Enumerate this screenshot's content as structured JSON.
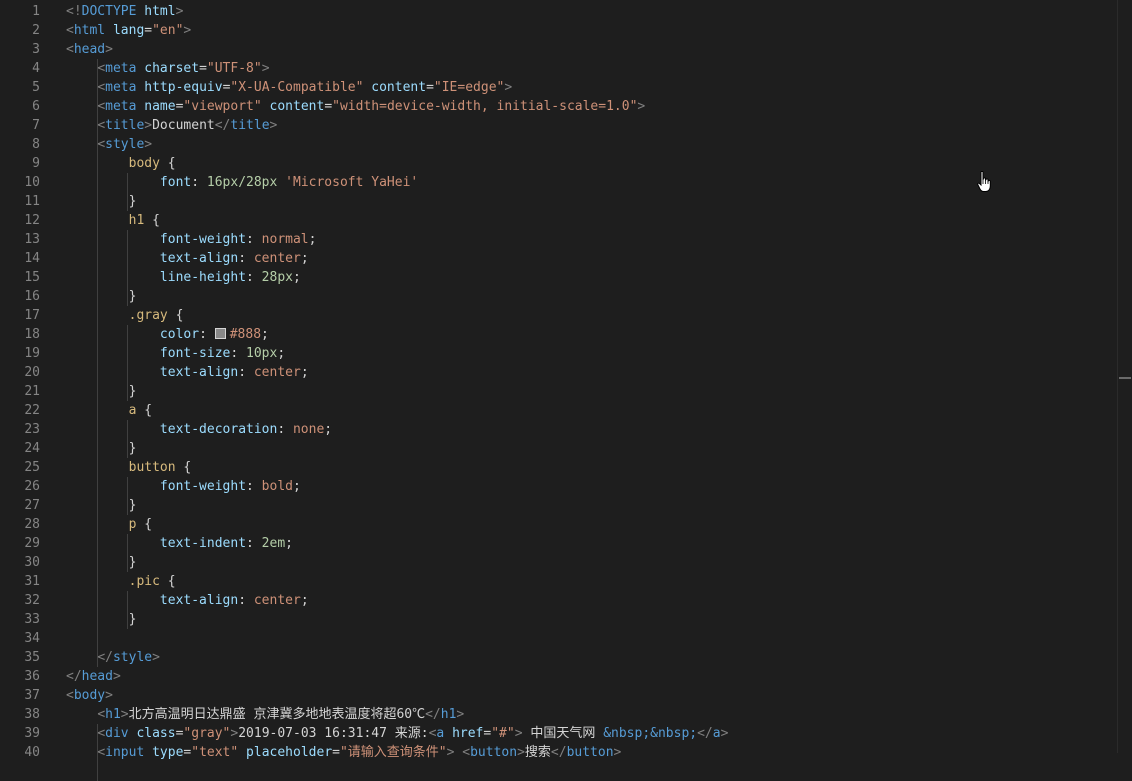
{
  "editor": {
    "line_numbers": [
      "1",
      "2",
      "3",
      "4",
      "5",
      "6",
      "7",
      "8",
      "9",
      "10",
      "11",
      "12",
      "13",
      "14",
      "15",
      "16",
      "17",
      "18",
      "19",
      "20",
      "21",
      "22",
      "23",
      "24",
      "25",
      "26",
      "27",
      "28",
      "29",
      "30",
      "31",
      "32",
      "33",
      "34",
      "35",
      "36",
      "37",
      "38",
      "39",
      "40"
    ],
    "lines": [
      [
        [
          "punc",
          "<!"
        ],
        [
          "tag",
          "DOCTYPE"
        ],
        [
          "text",
          " "
        ],
        [
          "attr",
          "html"
        ],
        [
          "punc",
          ">"
        ]
      ],
      [
        [
          "punc",
          "<"
        ],
        [
          "tag",
          "html"
        ],
        [
          "text",
          " "
        ],
        [
          "attr",
          "lang"
        ],
        [
          "text",
          "="
        ],
        [
          "str",
          "\"en\""
        ],
        [
          "punc",
          ">"
        ]
      ],
      [
        [
          "punc",
          "<"
        ],
        [
          "tag",
          "head"
        ],
        [
          "punc",
          ">"
        ]
      ],
      [
        [
          "text",
          "    "
        ],
        [
          "punc",
          "<"
        ],
        [
          "tag",
          "meta"
        ],
        [
          "text",
          " "
        ],
        [
          "attr",
          "charset"
        ],
        [
          "text",
          "="
        ],
        [
          "str",
          "\"UTF-8\""
        ],
        [
          "punc",
          ">"
        ]
      ],
      [
        [
          "text",
          "    "
        ],
        [
          "punc",
          "<"
        ],
        [
          "tag",
          "meta"
        ],
        [
          "text",
          " "
        ],
        [
          "attr",
          "http-equiv"
        ],
        [
          "text",
          "="
        ],
        [
          "str",
          "\"X-UA-Compatible\""
        ],
        [
          "text",
          " "
        ],
        [
          "attr",
          "content"
        ],
        [
          "text",
          "="
        ],
        [
          "str",
          "\"IE=edge\""
        ],
        [
          "punc",
          ">"
        ]
      ],
      [
        [
          "text",
          "    "
        ],
        [
          "punc",
          "<"
        ],
        [
          "tag",
          "meta"
        ],
        [
          "text",
          " "
        ],
        [
          "attr",
          "name"
        ],
        [
          "text",
          "="
        ],
        [
          "str",
          "\"viewport\""
        ],
        [
          "text",
          " "
        ],
        [
          "attr",
          "content"
        ],
        [
          "text",
          "="
        ],
        [
          "str",
          "\"width=device-width, initial-scale=1.0\""
        ],
        [
          "punc",
          ">"
        ]
      ],
      [
        [
          "text",
          "    "
        ],
        [
          "punc",
          "<"
        ],
        [
          "tag",
          "title"
        ],
        [
          "punc",
          ">"
        ],
        [
          "text",
          "Document"
        ],
        [
          "punc",
          "</"
        ],
        [
          "tag",
          "title"
        ],
        [
          "punc",
          ">"
        ]
      ],
      [
        [
          "text",
          "    "
        ],
        [
          "punc",
          "<"
        ],
        [
          "tag",
          "style"
        ],
        [
          "punc",
          ">"
        ]
      ],
      [
        [
          "text",
          "        "
        ],
        [
          "sel",
          "body"
        ],
        [
          "text",
          " {"
        ]
      ],
      [
        [
          "text",
          "            "
        ],
        [
          "prop",
          "font"
        ],
        [
          "text",
          ": "
        ],
        [
          "num",
          "16px/28px"
        ],
        [
          "text",
          " "
        ],
        [
          "str",
          "'Microsoft YaHei'"
        ]
      ],
      [
        [
          "text",
          "        }"
        ]
      ],
      [
        [
          "text",
          "        "
        ],
        [
          "sel",
          "h1"
        ],
        [
          "text",
          " {"
        ]
      ],
      [
        [
          "text",
          "            "
        ],
        [
          "prop",
          "font-weight"
        ],
        [
          "text",
          ": "
        ],
        [
          "str",
          "normal"
        ],
        [
          "text",
          ";"
        ]
      ],
      [
        [
          "text",
          "            "
        ],
        [
          "prop",
          "text-align"
        ],
        [
          "text",
          ": "
        ],
        [
          "str",
          "center"
        ],
        [
          "text",
          ";"
        ]
      ],
      [
        [
          "text",
          "            "
        ],
        [
          "prop",
          "line-height"
        ],
        [
          "text",
          ": "
        ],
        [
          "num",
          "28px"
        ],
        [
          "text",
          ";"
        ]
      ],
      [
        [
          "text",
          "        }"
        ]
      ],
      [
        [
          "text",
          "        "
        ],
        [
          "sel",
          ".gray"
        ],
        [
          "text",
          " {"
        ]
      ],
      [
        [
          "text",
          "            "
        ],
        [
          "prop",
          "color"
        ],
        [
          "text",
          ": "
        ],
        [
          "swatch",
          ""
        ],
        [
          "str",
          "#888"
        ],
        [
          "text",
          ";"
        ]
      ],
      [
        [
          "text",
          "            "
        ],
        [
          "prop",
          "font-size"
        ],
        [
          "text",
          ": "
        ],
        [
          "num",
          "10px"
        ],
        [
          "text",
          ";"
        ]
      ],
      [
        [
          "text",
          "            "
        ],
        [
          "prop",
          "text-align"
        ],
        [
          "text",
          ": "
        ],
        [
          "str",
          "center"
        ],
        [
          "text",
          ";"
        ]
      ],
      [
        [
          "text",
          "        }"
        ]
      ],
      [
        [
          "text",
          "        "
        ],
        [
          "sel",
          "a"
        ],
        [
          "text",
          " {"
        ]
      ],
      [
        [
          "text",
          "            "
        ],
        [
          "prop",
          "text-decoration"
        ],
        [
          "text",
          ": "
        ],
        [
          "str",
          "none"
        ],
        [
          "text",
          ";"
        ]
      ],
      [
        [
          "text",
          "        }"
        ]
      ],
      [
        [
          "text",
          "        "
        ],
        [
          "sel",
          "button"
        ],
        [
          "text",
          " {"
        ]
      ],
      [
        [
          "text",
          "            "
        ],
        [
          "prop",
          "font-weight"
        ],
        [
          "text",
          ": "
        ],
        [
          "str",
          "bold"
        ],
        [
          "text",
          ";"
        ]
      ],
      [
        [
          "text",
          "        }"
        ]
      ],
      [
        [
          "text",
          "        "
        ],
        [
          "sel",
          "p"
        ],
        [
          "text",
          " {"
        ]
      ],
      [
        [
          "text",
          "            "
        ],
        [
          "prop",
          "text-indent"
        ],
        [
          "text",
          ": "
        ],
        [
          "num",
          "2em"
        ],
        [
          "text",
          ";"
        ]
      ],
      [
        [
          "text",
          "        }"
        ]
      ],
      [
        [
          "text",
          "        "
        ],
        [
          "sel",
          ".pic"
        ],
        [
          "text",
          " {"
        ]
      ],
      [
        [
          "text",
          "            "
        ],
        [
          "prop",
          "text-align"
        ],
        [
          "text",
          ": "
        ],
        [
          "str",
          "center"
        ],
        [
          "text",
          ";"
        ]
      ],
      [
        [
          "text",
          "        }"
        ]
      ],
      [],
      [
        [
          "text",
          "    "
        ],
        [
          "punc",
          "</"
        ],
        [
          "tag",
          "style"
        ],
        [
          "punc",
          ">"
        ]
      ],
      [
        [
          "punc",
          "</"
        ],
        [
          "tag",
          "head"
        ],
        [
          "punc",
          ">"
        ]
      ],
      [
        [
          "punc",
          "<"
        ],
        [
          "tag",
          "body"
        ],
        [
          "punc",
          ">"
        ]
      ],
      [
        [
          "text",
          "    "
        ],
        [
          "punc",
          "<"
        ],
        [
          "tag",
          "h1"
        ],
        [
          "punc",
          ">"
        ],
        [
          "text",
          "北方高温明日达鼎盛 京津冀多地地表温度将超60℃"
        ],
        [
          "punc",
          "</"
        ],
        [
          "tag",
          "h1"
        ],
        [
          "punc",
          ">"
        ]
      ],
      [
        [
          "text",
          "    "
        ],
        [
          "punc",
          "<"
        ],
        [
          "tag",
          "div"
        ],
        [
          "text",
          " "
        ],
        [
          "attr",
          "class"
        ],
        [
          "text",
          "="
        ],
        [
          "str",
          "\"gray\""
        ],
        [
          "punc",
          ">"
        ],
        [
          "text",
          "2019-07-03 16:31:47 来源:"
        ],
        [
          "punc",
          "<"
        ],
        [
          "tag",
          "a"
        ],
        [
          "text",
          " "
        ],
        [
          "attr",
          "href"
        ],
        [
          "text",
          "="
        ],
        [
          "str",
          "\"#\""
        ],
        [
          "punc",
          ">"
        ],
        [
          "text",
          " 中国天气网 "
        ],
        [
          "ent",
          "&nbsp;&nbsp;"
        ],
        [
          "punc",
          "</"
        ],
        [
          "tag",
          "a"
        ],
        [
          "punc",
          ">"
        ]
      ],
      [
        [
          "text",
          "    "
        ],
        [
          "punc",
          "<"
        ],
        [
          "tag",
          "input"
        ],
        [
          "text",
          " "
        ],
        [
          "attr",
          "type"
        ],
        [
          "text",
          "="
        ],
        [
          "str",
          "\"text\""
        ],
        [
          "text",
          " "
        ],
        [
          "attr",
          "placeholder"
        ],
        [
          "text",
          "="
        ],
        [
          "str",
          "\"请输入查询条件\""
        ],
        [
          "punc",
          ">"
        ],
        [
          "text",
          " "
        ],
        [
          "punc",
          "<"
        ],
        [
          "tag",
          "button"
        ],
        [
          "punc",
          ">"
        ],
        [
          "text",
          "搜索"
        ],
        [
          "punc",
          "</"
        ],
        [
          "tag",
          "button"
        ],
        [
          "punc",
          ">"
        ]
      ]
    ]
  },
  "colors": {
    "background": "#1e1e1e",
    "line_number": "#858585",
    "tag": "#569cd6",
    "attribute": "#9cdcfe",
    "string": "#ce9178",
    "selector": "#d7ba7d",
    "number": "#b5cea8",
    "swatch": "#888888"
  },
  "icons": {
    "cursor": "hand-pointer-icon",
    "color_swatch": "color-swatch-icon"
  }
}
